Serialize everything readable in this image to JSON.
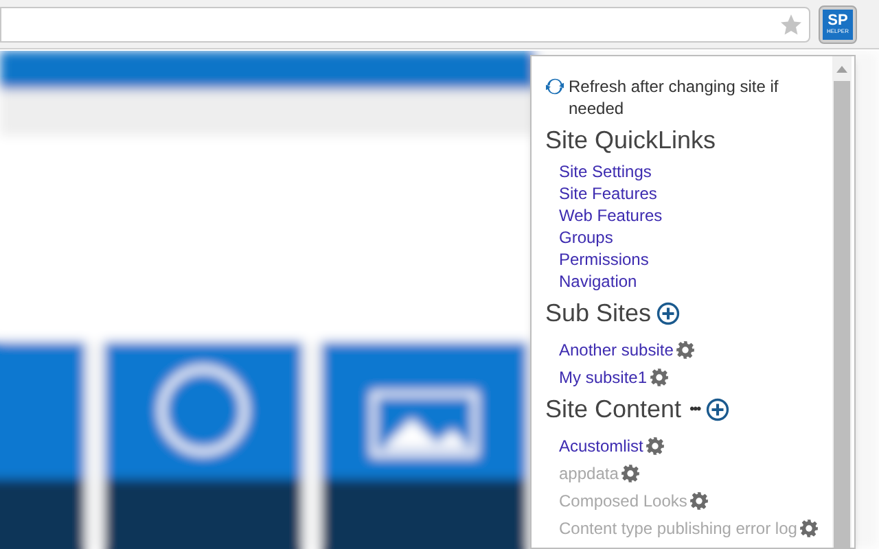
{
  "popup": {
    "refresh_note": "Refresh after changing site if needed",
    "sections": [
      {
        "kind": "links",
        "title": "Site QuickLinks",
        "items": [
          {
            "label": "Site Settings"
          },
          {
            "label": "Site Features"
          },
          {
            "label": "Web Features"
          },
          {
            "label": "Groups"
          },
          {
            "label": "Permissions"
          },
          {
            "label": "Navigation"
          }
        ]
      },
      {
        "kind": "subsites",
        "title": "Sub Sites",
        "items": [
          {
            "label": "Another subsite",
            "hidden": false
          },
          {
            "label": "My subsite1",
            "hidden": false
          }
        ]
      },
      {
        "kind": "content",
        "title": "Site Content",
        "more": "•••",
        "items": [
          {
            "label": "Acustomlist",
            "hidden": false
          },
          {
            "label": "appdata",
            "hidden": true
          },
          {
            "label": "Composed Looks",
            "hidden": true
          },
          {
            "label": "Content type publishing error log",
            "hidden": true
          }
        ]
      }
    ]
  },
  "extension_button": {
    "top": "SP",
    "bottom": "HELPER"
  }
}
